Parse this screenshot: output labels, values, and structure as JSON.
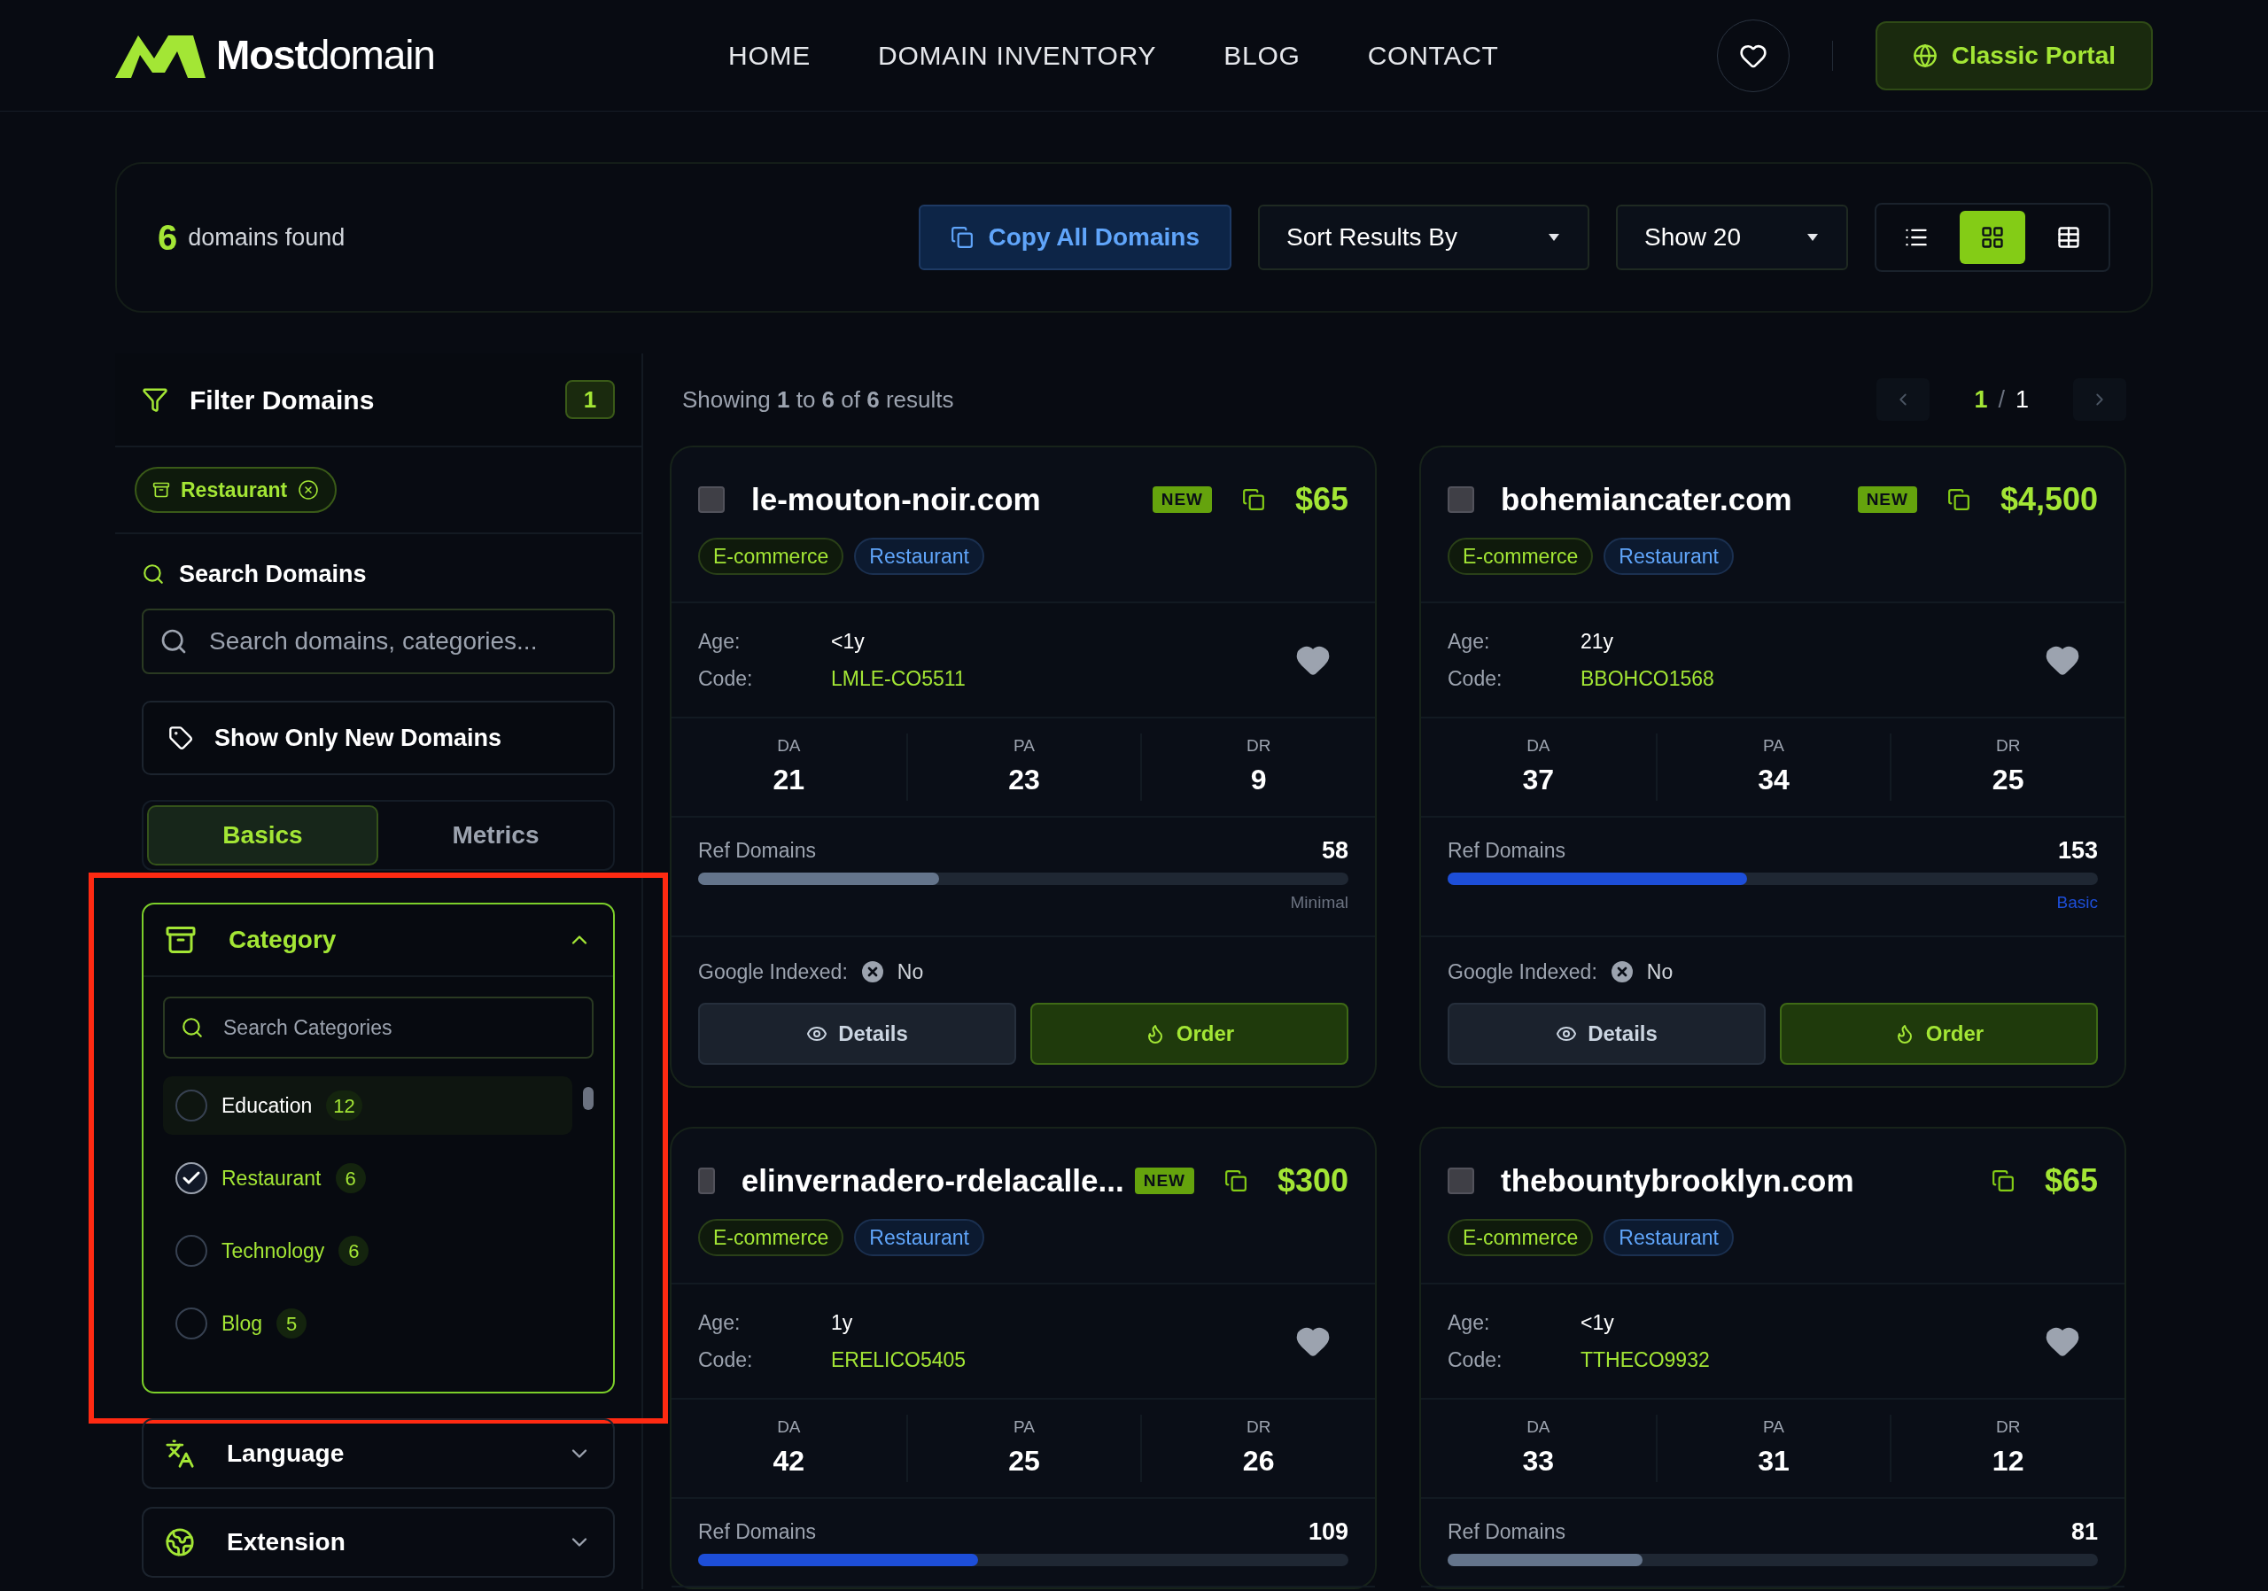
{
  "header": {
    "brand": "**Most**domain",
    "nav": [
      {
        "label": "HOME"
      },
      {
        "label": "DOMAIN INVENTORY"
      },
      {
        "label": "BLOG"
      },
      {
        "label": "CONTACT"
      }
    ],
    "portal_button": "Classic Portal"
  },
  "toolbar": {
    "count": "6",
    "count_label": "domains found",
    "copy_button": "Copy All Domains",
    "sort": "Sort Results By",
    "show": "Show 20",
    "views": [
      {
        "kind": "list",
        "selected": false
      },
      {
        "kind": "grid",
        "selected": true
      },
      {
        "kind": "table",
        "selected": false
      }
    ]
  },
  "sidebar": {
    "title": "Filter Domains",
    "active_count": "1",
    "active_filters": [
      {
        "label": "Restaurant"
      }
    ],
    "search_title": "Search Domains",
    "search": {
      "placeholder": "Search domains, categories..."
    },
    "new_only_button": "Show Only New Domains",
    "tabs": [
      {
        "label": "Basics",
        "selected": true
      },
      {
        "label": "Metrics",
        "selected": false
      }
    ],
    "category": {
      "title": "Category",
      "expanded": true,
      "search": {
        "placeholder": "Search Categories"
      },
      "items": [
        {
          "label": "Education",
          "count": "12",
          "checked": false,
          "hovered": true
        },
        {
          "label": "Restaurant",
          "count": "6",
          "checked": true,
          "hovered": false
        },
        {
          "label": "Technology",
          "count": "6",
          "checked": false,
          "hovered": false
        },
        {
          "label": "Blog",
          "count": "5",
          "checked": false,
          "hovered": false
        }
      ]
    },
    "sections": [
      {
        "kind": "language",
        "title": "Language",
        "expanded": false
      },
      {
        "kind": "extension",
        "title": "Extension",
        "expanded": false
      }
    ]
  },
  "results": {
    "summary": "Showing **1** to **6** of **6** results",
    "page": "1",
    "pages": "1",
    "separator": "/"
  },
  "domains": [
    {
      "name": "le-mouton-noir.com",
      "checked": false,
      "badge": "NEW",
      "price": "$65",
      "tags": [
        {
          "label": "E-commerce",
          "kind": "industry"
        },
        {
          "label": "Restaurant",
          "kind": "category"
        }
      ],
      "favorite": false,
      "fields": [
        {
          "label": "Age:",
          "value": "<1y",
          "kind": "plain"
        },
        {
          "label": "Code:",
          "value": "LMLE-CO5511",
          "kind": "code"
        }
      ],
      "metrics": [
        {
          "label": "DA",
          "value": "21"
        },
        {
          "label": "PA",
          "value": "23"
        },
        {
          "label": "DR",
          "value": "9"
        }
      ],
      "ref": {
        "label": "Ref Domains",
        "value": "58",
        "level": 0.37,
        "color": "#64748b",
        "tier": "Minimal"
      },
      "indexed": {
        "label": "Google Indexed:",
        "value": "No",
        "on": false
      },
      "buttons": [
        {
          "label": "Details",
          "kind": "details"
        },
        {
          "label": "Order",
          "kind": "order"
        }
      ]
    },
    {
      "name": "bohemiancater.com",
      "checked": false,
      "badge": "NEW",
      "price": "$4,500",
      "tags": [
        {
          "label": "E-commerce",
          "kind": "industry"
        },
        {
          "label": "Restaurant",
          "kind": "category"
        }
      ],
      "favorite": false,
      "fields": [
        {
          "label": "Age:",
          "value": "21y",
          "kind": "plain"
        },
        {
          "label": "Code:",
          "value": "BBOHCO1568",
          "kind": "code"
        }
      ],
      "metrics": [
        {
          "label": "DA",
          "value": "37"
        },
        {
          "label": "PA",
          "value": "34"
        },
        {
          "label": "DR",
          "value": "25"
        }
      ],
      "ref": {
        "label": "Ref Domains",
        "value": "153",
        "level": 0.46,
        "color": "#1d4ed8",
        "tier": "Basic"
      },
      "indexed": {
        "label": "Google Indexed:",
        "value": "No",
        "on": false
      },
      "buttons": [
        {
          "label": "Details",
          "kind": "details"
        },
        {
          "label": "Order",
          "kind": "order"
        }
      ]
    },
    {
      "name": "elinvernadero-rdelacalle...",
      "checked": false,
      "badge": "NEW",
      "price": "$300",
      "tags": [
        {
          "label": "E-commerce",
          "kind": "industry"
        },
        {
          "label": "Restaurant",
          "kind": "category"
        }
      ],
      "favorite": false,
      "fields": [
        {
          "label": "Age:",
          "value": "1y",
          "kind": "plain"
        },
        {
          "label": "Code:",
          "value": "ERELICO5405",
          "kind": "code"
        }
      ],
      "metrics": [
        {
          "label": "DA",
          "value": "42"
        },
        {
          "label": "PA",
          "value": "25"
        },
        {
          "label": "DR",
          "value": "26"
        }
      ],
      "ref": {
        "label": "Ref Domains",
        "value": "109",
        "level": 0.43,
        "color": "#1d4ed8"
      }
    },
    {
      "name": "thebountybrooklyn.com",
      "checked": false,
      "price": "$65",
      "tags": [
        {
          "label": "E-commerce",
          "kind": "industry"
        },
        {
          "label": "Restaurant",
          "kind": "category"
        }
      ],
      "favorite": false,
      "fields": [
        {
          "label": "Age:",
          "value": "<1y",
          "kind": "plain"
        },
        {
          "label": "Code:",
          "value": "TTHECO9932",
          "kind": "code"
        }
      ],
      "metrics": [
        {
          "label": "DA",
          "value": "33"
        },
        {
          "label": "PA",
          "value": "31"
        },
        {
          "label": "DR",
          "value": "12"
        }
      ],
      "ref": {
        "label": "Ref Domains",
        "value": "81",
        "level": 0.3,
        "color": "#64748b"
      }
    }
  ]
}
